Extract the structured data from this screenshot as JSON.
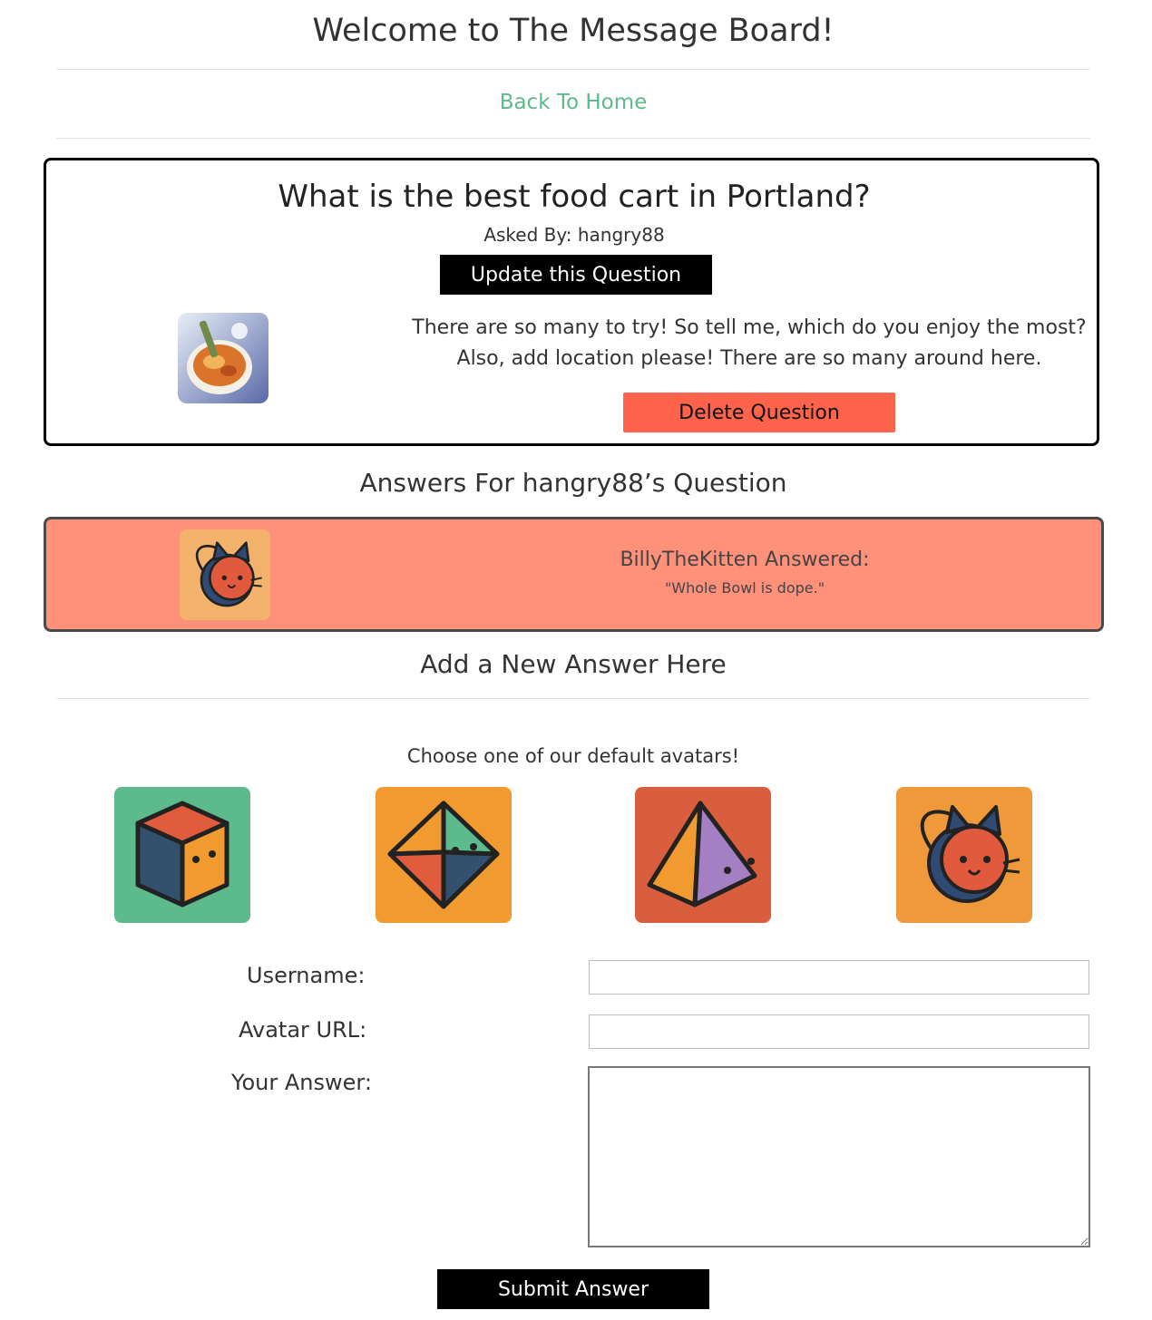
{
  "header": {
    "title": "Welcome to The Message Board!",
    "home_link": "Back To Home"
  },
  "question": {
    "title": "What is the best food cart in Portland?",
    "asked_by": "Asked By: hangry88",
    "update_label": "Update this Question",
    "body": "There are so many to try! So tell me, which do you enjoy the most? Also, add location please! There are so many around here.",
    "delete_label": "Delete Question",
    "avatar_icon": "food-bowl-photo"
  },
  "answers": {
    "heading": "Answers For hangry88’s Question",
    "items": [
      {
        "user_line": "BillyTheKitten Answered:",
        "text": "\"Whole Bowl is dope.\"",
        "avatar_icon": "cat-avatar-icon",
        "bg_color": "#ff917b"
      }
    ]
  },
  "new_answer": {
    "heading": "Add a New Answer Here",
    "choose_text": "Choose one of our default avatars!",
    "avatars": [
      {
        "icon": "cube-avatar-icon",
        "bg": "#5dba8c"
      },
      {
        "icon": "octahedron-avatar-icon",
        "bg": "#f19a30"
      },
      {
        "icon": "pyramid-avatar-icon",
        "bg": "#d95e3d"
      },
      {
        "icon": "cat-avatar-icon",
        "bg": "#f0993a"
      }
    ],
    "username_label": "Username:",
    "username_value": "",
    "avatar_url_label": "Avatar URL:",
    "avatar_url_value": "",
    "answer_label": "Your Answer:",
    "answer_value": "",
    "submit_label": "Submit Answer"
  },
  "colors": {
    "link": "#5dba8c",
    "delete": "#ff634b",
    "answer_card": "#ff917b"
  }
}
